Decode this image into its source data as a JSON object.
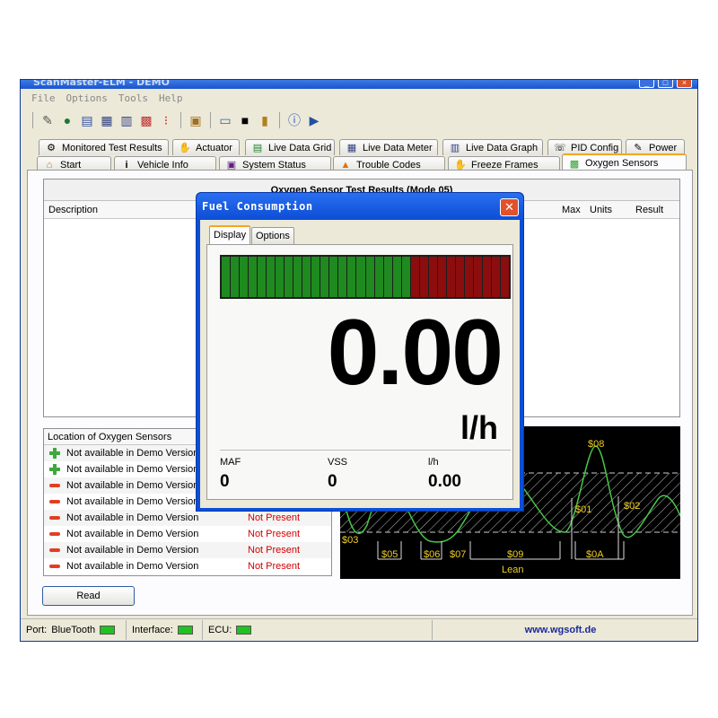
{
  "window": {
    "title": "ScanMaster-ELM - DEMO",
    "controls": [
      "_",
      "□",
      "×"
    ]
  },
  "menu": [
    "File",
    "Options",
    "Tools",
    "Help"
  ],
  "toolbar": {
    "icons": [
      "wrench-icon",
      "globe-icon",
      "document-icon",
      "grid-icon",
      "chart-icon",
      "colors-icon",
      "traffic-light-icon",
      "clipboard-icon",
      "chat-icon",
      "terminal-icon",
      "battery-icon",
      "info-icon",
      "exit-icon"
    ]
  },
  "tabs_row1": [
    {
      "label": "Monitored Test Results",
      "icon": "gear-icon"
    },
    {
      "label": "Actuator",
      "icon": "hand-icon"
    },
    {
      "label": "Live Data Grid",
      "icon": "list-icon"
    },
    {
      "label": "Live Data Meter",
      "icon": "grid-icon"
    },
    {
      "label": "Live Data Graph",
      "icon": "chart-icon"
    },
    {
      "label": "PID Config",
      "icon": "phone-icon"
    },
    {
      "label": "Power",
      "icon": "pen-icon"
    }
  ],
  "tabs_row2": [
    {
      "label": "Start",
      "icon": "home-icon"
    },
    {
      "label": "Vehicle Info",
      "icon": "info-icon"
    },
    {
      "label": "System Status",
      "icon": "checklist-icon"
    },
    {
      "label": "Trouble Codes",
      "icon": "warning-icon"
    },
    {
      "label": "Freeze Frames",
      "icon": "hand-icon"
    },
    {
      "label": "Oxygen Sensors",
      "icon": "sensor-icon",
      "active": true
    }
  ],
  "results": {
    "title": "Oxygen Sensor Test Results (Mode 05)",
    "columns": {
      "description": "Description",
      "max": "Max",
      "units": "Units",
      "result": "Result"
    }
  },
  "sensors": {
    "header": "Location of Oxygen Sensors",
    "rows": [
      {
        "label": "Not available in Demo Version",
        "status": "",
        "icon": "plus"
      },
      {
        "label": "Not available in Demo Version",
        "status": "",
        "icon": "plus"
      },
      {
        "label": "Not available in Demo Version",
        "status": "",
        "icon": "minus"
      },
      {
        "label": "Not available in Demo Version",
        "status": "",
        "icon": "minus"
      },
      {
        "label": "Not available in Demo Version",
        "status": "Not Present",
        "icon": "minus"
      },
      {
        "label": "Not available in Demo Version",
        "status": "Not Present",
        "icon": "minus"
      },
      {
        "label": "Not available in Demo Version",
        "status": "Not Present",
        "icon": "minus"
      },
      {
        "label": "Not available in Demo Version",
        "status": "Not Present",
        "icon": "minus"
      }
    ]
  },
  "graph": {
    "labels": [
      "$08",
      "$01",
      "$02",
      "$03",
      "$05",
      "$06",
      "$07",
      "$09",
      "$0A",
      "Lean"
    ]
  },
  "read_button": "Read",
  "statusbar": {
    "port_label": "Port:",
    "port_value": "BlueTooth",
    "interface_label": "Interface:",
    "ecu_label": "ECU:",
    "website": "www.wgsoft.de",
    "led_color": "#22c022"
  },
  "dialog": {
    "title": "Fuel Consumption",
    "tabs": [
      "Display",
      "Options"
    ],
    "bar": {
      "green_segments": 21,
      "red_segments": 11
    },
    "value": "0.00",
    "unit": "l/h",
    "metrics": [
      {
        "label": "MAF",
        "value": "0"
      },
      {
        "label": "VSS",
        "value": "0"
      },
      {
        "label": "l/h",
        "value": "0.00"
      }
    ]
  },
  "colors": {
    "accent": "#f4a623",
    "title_blue": "#0c4ed6",
    "graph_line": "#45c845",
    "graph_text": "#f0d020"
  }
}
